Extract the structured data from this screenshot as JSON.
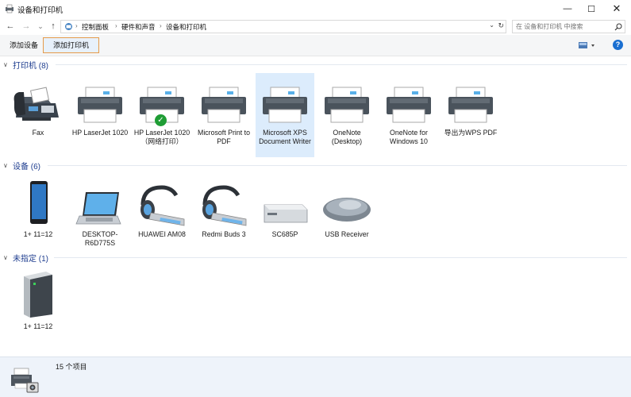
{
  "window": {
    "title": "设备和打印机",
    "minimize_glyph": "—",
    "maximize_glyph": "☐",
    "close_glyph": "✕"
  },
  "nav": {
    "back_glyph": "←",
    "forward_glyph": "→",
    "recent_glyph": "⌄",
    "up_glyph": "↑"
  },
  "address": {
    "crumbs": [
      "控制面板",
      "硬件和声音",
      "设备和打印机"
    ],
    "separator": "›",
    "dropdown_glyph": "⌄",
    "refresh_glyph": "↻"
  },
  "search": {
    "placeholder": "在 设备和打印机 中搜索",
    "icon": "search-icon"
  },
  "toolbar": {
    "add_device": "添加设备",
    "add_printer": "添加打印机",
    "help": "?"
  },
  "sections": {
    "printers": {
      "label": "打印机 (8)",
      "chevron": "∨"
    },
    "devices": {
      "label": "设备 (6)",
      "chevron": "∨"
    },
    "unspecified": {
      "label": "未指定 (1)",
      "chevron": "∨"
    }
  },
  "printers": [
    {
      "name": "Fax",
      "icon": "fax-icon"
    },
    {
      "name": "HP LaserJet 1020",
      "icon": "printer-icon"
    },
    {
      "name": "HP LaserJet 1020（网络打印）",
      "icon": "printer-default-icon",
      "default": true
    },
    {
      "name": "Microsoft Print to PDF",
      "icon": "printer-icon"
    },
    {
      "name": "Microsoft XPS Document Writer",
      "icon": "printer-icon",
      "selected": true
    },
    {
      "name": "OneNote (Desktop)",
      "icon": "printer-icon"
    },
    {
      "name": "OneNote for Windows 10",
      "icon": "printer-icon"
    },
    {
      "name": "导出为WPS PDF",
      "icon": "printer-icon"
    }
  ],
  "devices": [
    {
      "name": "1+ 11=12",
      "icon": "phone-icon"
    },
    {
      "name": "DESKTOP-R6D775S",
      "icon": "laptop-icon"
    },
    {
      "name": "HUAWEI AM08",
      "icon": "headset-icon"
    },
    {
      "name": "Redmi Buds 3",
      "icon": "headset-icon"
    },
    {
      "name": "SC685P",
      "icon": "device-box-icon"
    },
    {
      "name": "USB Receiver",
      "icon": "mouse-icon"
    }
  ],
  "unspecified": [
    {
      "name": "1+ 11=12",
      "icon": "server-icon"
    }
  ],
  "status": {
    "count": "15 个项目"
  },
  "colors": {
    "accent": "#1a6fd1",
    "section_label": "#1e3d8f",
    "selection": "#dcecfc",
    "highlight_border": "#e59b4b",
    "status_bg": "#eef3fa"
  }
}
